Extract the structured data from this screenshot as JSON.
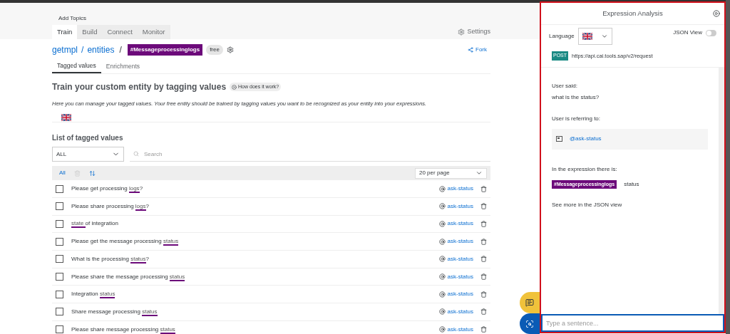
{
  "header": {
    "add_topics": "Add Topics",
    "tabs": [
      {
        "label": "Train",
        "selected": true
      },
      {
        "label": "Build",
        "selected": false
      },
      {
        "label": "Connect",
        "selected": false
      },
      {
        "label": "Monitor",
        "selected": false
      }
    ],
    "settings": "Settings"
  },
  "breadcrumb": {
    "bot": "getmpl",
    "section": "entities",
    "separator": "/",
    "entity": "#Messageprocessinglogs",
    "badge": "free"
  },
  "fork": "Fork",
  "subtabs": [
    {
      "label": "Tagged values",
      "selected": true
    },
    {
      "label": "Enrichments",
      "selected": false
    }
  ],
  "heading": "Train your custom entity by tagging values",
  "help_chip": "How does it work?",
  "description": "Here you can manage your tagged values. Your free entity should be trained by tagging values you want to be recognized as your entity into your expressions.",
  "list_title": "List of tagged values",
  "filter": {
    "value": "ALL"
  },
  "search": {
    "placeholder": "Search"
  },
  "toolbar": {
    "all": "All",
    "per_page": "20 per page"
  },
  "rows": [
    {
      "before": "Please get processing ",
      "tagged": "logs",
      "after": "?",
      "intent": "ask-status",
      "checked": false
    },
    {
      "before": "Please share processing ",
      "tagged": "logs",
      "after": "?",
      "intent": "ask-status",
      "checked": false
    },
    {
      "before": "",
      "tagged": "state ",
      "after": "of integration",
      "intent": "ask-status",
      "checked": false
    },
    {
      "before": "Please get the message processing ",
      "tagged": "status",
      "after": "",
      "intent": "ask-status",
      "checked": false
    },
    {
      "before": "What is the processing ",
      "tagged": "status",
      "after": "?",
      "intent": "ask-status",
      "checked": false
    },
    {
      "before": "Please share the message processing ",
      "tagged": "status",
      "after": "",
      "intent": "ask-status",
      "checked": false
    },
    {
      "before": "Integration ",
      "tagged": "status",
      "after": "",
      "intent": "ask-status",
      "checked": false
    },
    {
      "before": "Share message processing ",
      "tagged": "status",
      "after": "",
      "intent": "ask-status",
      "checked": false
    },
    {
      "before": "Please share message processing ",
      "tagged": "status",
      "after": "",
      "intent": "ask-status",
      "checked": false
    }
  ],
  "panel": {
    "title": "Expression Analysis",
    "language_label": "Language",
    "json_view": {
      "label": "JSON View",
      "on": false
    },
    "method": "POST",
    "url": "https://api.cai.tools.sap/v2/request",
    "user_said_label": "User said:",
    "user_said": "what is the status?",
    "referring_label": "User is referring to:",
    "intent": "@ask-status",
    "expression_label": "In the expression there is:",
    "entity": "#Messageprocessinglogs",
    "entity_value": "status",
    "see_more": "See more in the JSON view",
    "input": {
      "placeholder": "Type a sentence..."
    }
  }
}
